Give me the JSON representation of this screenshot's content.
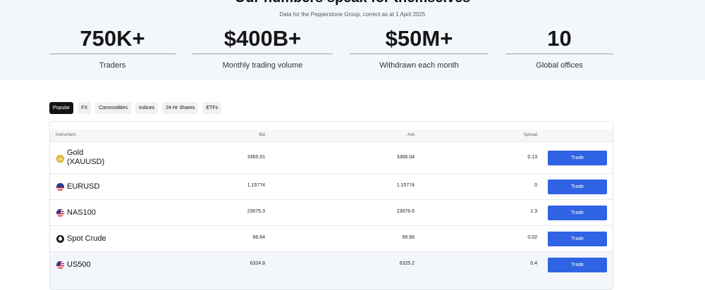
{
  "header": {
    "title": "Our numbers speak for themselves",
    "subtitle": "Data for the Pepperstone Group, correct as at 1 April 2025"
  },
  "stats": [
    {
      "value": "750K+",
      "label": "Traders"
    },
    {
      "value": "$400B+",
      "label": "Monthly trading volume"
    },
    {
      "value": "$50M+",
      "label": "Withdrawn each month"
    },
    {
      "value": "10",
      "label": "Global offices"
    }
  ],
  "tabs": [
    {
      "label": "Popular",
      "active": true
    },
    {
      "label": "FX",
      "active": false
    },
    {
      "label": "Commodities",
      "active": false
    },
    {
      "label": "Indices",
      "active": false
    },
    {
      "label": "24 Hr Shares",
      "active": false
    },
    {
      "label": "ETFs",
      "active": false
    }
  ],
  "table": {
    "columns": [
      "Instrument",
      "Bid",
      "Ask",
      "Spread"
    ],
    "rows": [
      {
        "name_line1": "Gold",
        "name_line2": "(XAUUSD)",
        "icon": "gold-bar-icon",
        "bid": "3365.91",
        "ask": "3366.04",
        "spread": "0.13",
        "action": "Trade"
      },
      {
        "name_line1": "EURUSD",
        "name_line2": "",
        "icon": "eu-us-flag-icon",
        "bid": "1.15774",
        "ask": "1.15774",
        "spread": "0",
        "action": "Trade"
      },
      {
        "name_line1": "NAS100",
        "name_line2": "",
        "icon": "us-flag-icon",
        "bid": "23075.3",
        "ask": "23076.6",
        "spread": "1.3",
        "action": "Trade"
      },
      {
        "name_line1": "Spot Crude",
        "name_line2": "",
        "icon": "oil-drop-icon",
        "bid": "66.64",
        "ask": "66.66",
        "spread": "0.02",
        "action": "Trade"
      },
      {
        "name_line1": "US500",
        "name_line2": "",
        "icon": "us-flag-icon",
        "bid": "6324.8",
        "ask": "6325.2",
        "spread": "0.4",
        "action": "Trade"
      }
    ]
  },
  "colors": {
    "band_bg": "#f3f7fc",
    "accent": "#2f63e3",
    "active_tab": "#141414"
  }
}
